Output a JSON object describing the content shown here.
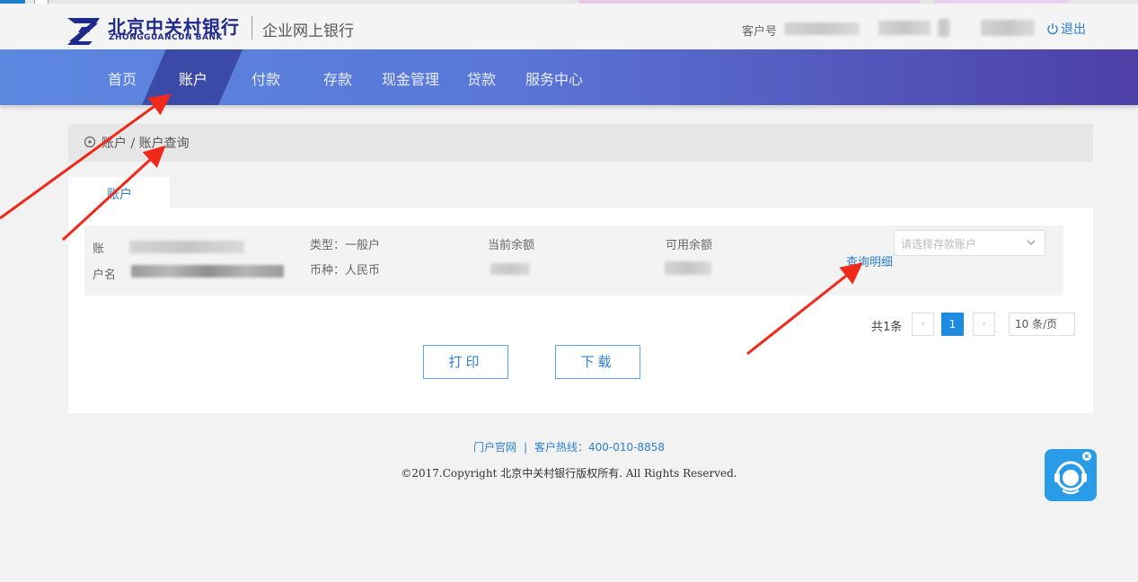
{
  "header": {
    "logo_cn": "北京中关村银行",
    "logo_en": "ZHONGGUANCUN BANK",
    "subtitle": "企业网上银行",
    "customer_label": "客户号",
    "logout": "退出"
  },
  "nav": {
    "items": [
      "首页",
      "账户",
      "付款",
      "存款",
      "现金管理",
      "贷款",
      "服务中心"
    ],
    "active": "账户"
  },
  "breadcrumb": "账户 / 账户查询",
  "tab": "账户",
  "account": {
    "no_label": "账",
    "name_label": "户名",
    "type": "类型：一般户",
    "currency": "币种：人民币",
    "current_balance_label": "当前余额",
    "available_balance_label": "可用余额",
    "detail_link": "查询明细",
    "select_placeholder": "请选择存款账户"
  },
  "pagination": {
    "total": "共1条",
    "prev": "‹",
    "current": "1",
    "next": "›",
    "page_size": "10 条/页"
  },
  "actions": {
    "print": "打印",
    "download": "下载"
  },
  "footer": {
    "portal": "门户官网",
    "hotline": "客户热线：400-010-8858",
    "copyright": "©2017.Copyright 北京中关村银行版权所有. All Rights Reserved."
  },
  "colors": {
    "accent": "#2d7fd1",
    "nav_start": "#5c88e0",
    "nav_end": "#4d3fa6",
    "annotation": "#f02a1a"
  }
}
